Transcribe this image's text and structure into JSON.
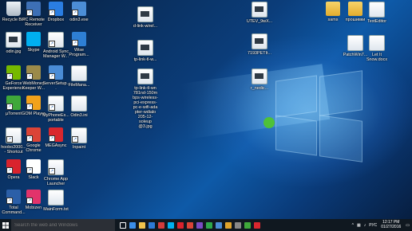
{
  "desktop": {
    "icons": [
      {
        "label": "Recycle Bin",
        "icon": "recycle-bin-icon",
        "color": "#cfd8e0"
      },
      {
        "label": "PC Remote Receiver",
        "icon": "pc-remote-icon",
        "color": "#3d6fb5"
      },
      {
        "label": "Dropbox",
        "icon": "dropbox-icon",
        "color": "#2a7de1"
      },
      {
        "label": "odin3.exe",
        "icon": "odin-icon",
        "color": "#4c8ed6"
      },
      {
        "label": "odin.jpg",
        "icon": "image-file-icon",
        "color": "#ffffff"
      },
      {
        "label": "Skype",
        "icon": "skype-icon",
        "color": "#00aff0"
      },
      {
        "label": "Android Sync Manager W...",
        "icon": "android-sync-icon",
        "color": "#ffffff"
      },
      {
        "label": "Wise Program...",
        "icon": "wise-icon",
        "color": "#2e7fd4"
      },
      {
        "label": "GeForce Experience",
        "icon": "geforce-icon",
        "color": "#76b900"
      },
      {
        "label": "WebMoney Keeper W...",
        "icon": "webmoney-icon",
        "color": "#9b8a4a"
      },
      {
        "label": "ServerSetup...",
        "icon": "server-setup-icon",
        "color": "#4a8cd6"
      },
      {
        "label": "FileMana...",
        "icon": "file-manager-icon",
        "color": "#ffffff"
      },
      {
        "label": "µTorrent",
        "icon": "utorrent-icon",
        "color": "#3fa83a"
      },
      {
        "label": "GOM Player",
        "icon": "gom-player-icon",
        "color": "#f2a21b"
      },
      {
        "label": "MyPhoneEx... portable",
        "icon": "myphoneexplorer-icon",
        "color": "#ffffff"
      },
      {
        "label": "Odin3.ini",
        "icon": "ini-file-icon",
        "color": "#ffffff"
      },
      {
        "label": "hoobo2000... - Shortcut",
        "icon": "shortcut-icon",
        "color": "#ffffff"
      },
      {
        "label": "Google Chrome",
        "icon": "chrome-icon",
        "color": "#db4437"
      },
      {
        "label": "MEGAsync",
        "icon": "megasync-icon",
        "color": "#d9272e"
      },
      {
        "label": "Inpaint",
        "icon": "inpaint-icon",
        "color": "#ffffff"
      },
      {
        "label": "Opera",
        "icon": "opera-icon",
        "color": "#d9232d"
      },
      {
        "label": "Slack",
        "icon": "slack-icon",
        "color": "#ffffff"
      },
      {
        "label": "Chrome App Launcher",
        "icon": "chrome-app-launcher-icon",
        "color": "#ffffff"
      },
      {
        "label": "Total Command...",
        "icon": "total-commander-icon",
        "color": "#2b5fa8"
      },
      {
        "label": "Mobizen",
        "icon": "mobizen-icon",
        "color": "#e2336b"
      },
      {
        "label": "MainForm.txt",
        "icon": "text-file-icon",
        "color": "#ffffff"
      },
      {
        "label": "d-link-wirel...",
        "icon": "image-file-icon",
        "color": "#ffffff"
      },
      {
        "label": "tp-link-tl-w...",
        "icon": "image-file-icon",
        "color": "#ffffff"
      },
      {
        "label": "tp-link-tl-wn 781nd-150m bps-wireless-pci-express-pc-e-wifi-ada pter-wdialo 205-12-soleup @3.jpg",
        "icon": "image-file-icon",
        "color": "#ffffff"
      },
      {
        "label": "UTEV_9wX...",
        "icon": "image-file-icon",
        "color": "#ffffff"
      },
      {
        "label": "7193PETIt...",
        "icon": "image-file-icon",
        "color": "#ffffff"
      },
      {
        "label": "r_nedic...",
        "icon": "image-file-icon",
        "color": "#ffffff"
      },
      {
        "label": "sams",
        "icon": "folder-icon",
        "color": "#f1c24c"
      },
      {
        "label": "прошивки",
        "icon": "folder-icon",
        "color": "#f1c24c"
      },
      {
        "label": "TextEditor",
        "icon": "text-editor-icon",
        "color": "#ffffff"
      },
      {
        "label": "PatchWin7...",
        "icon": "patch-file-icon",
        "color": "#ffffff"
      },
      {
        "label": "Let It Snow.docx",
        "icon": "word-document-icon",
        "color": "#ffffff"
      }
    ]
  },
  "taskbar": {
    "search_placeholder": "Search the web and Windows",
    "apps": [
      {
        "icon": "task-view-icon",
        "color": "#ffffff"
      },
      {
        "icon": "edge-icon",
        "color": "#3b8ee8"
      },
      {
        "icon": "file-explorer-icon",
        "color": "#f1c24c"
      },
      {
        "icon": "store-icon",
        "color": "#2d7ad6"
      },
      {
        "icon": "app-icon",
        "color": "#d13c3c"
      },
      {
        "icon": "skype-icon",
        "color": "#00aff0"
      },
      {
        "icon": "opera-icon",
        "color": "#d9232d"
      },
      {
        "icon": "chrome-icon",
        "color": "#db4437"
      },
      {
        "icon": "app-icon",
        "color": "#7a4bc4"
      },
      {
        "icon": "app-icon",
        "color": "#2ea84a"
      },
      {
        "icon": "app-icon",
        "color": "#4a8cd6"
      },
      {
        "icon": "app-icon",
        "color": "#e0a32b"
      },
      {
        "icon": "app-icon",
        "color": "#888888"
      },
      {
        "icon": "app-icon",
        "color": "#3fa83a"
      },
      {
        "icon": "app-icon",
        "color": "#d9272e"
      }
    ],
    "lang": "РУС",
    "time": "12:17 PM",
    "date": "01/27/2016"
  }
}
